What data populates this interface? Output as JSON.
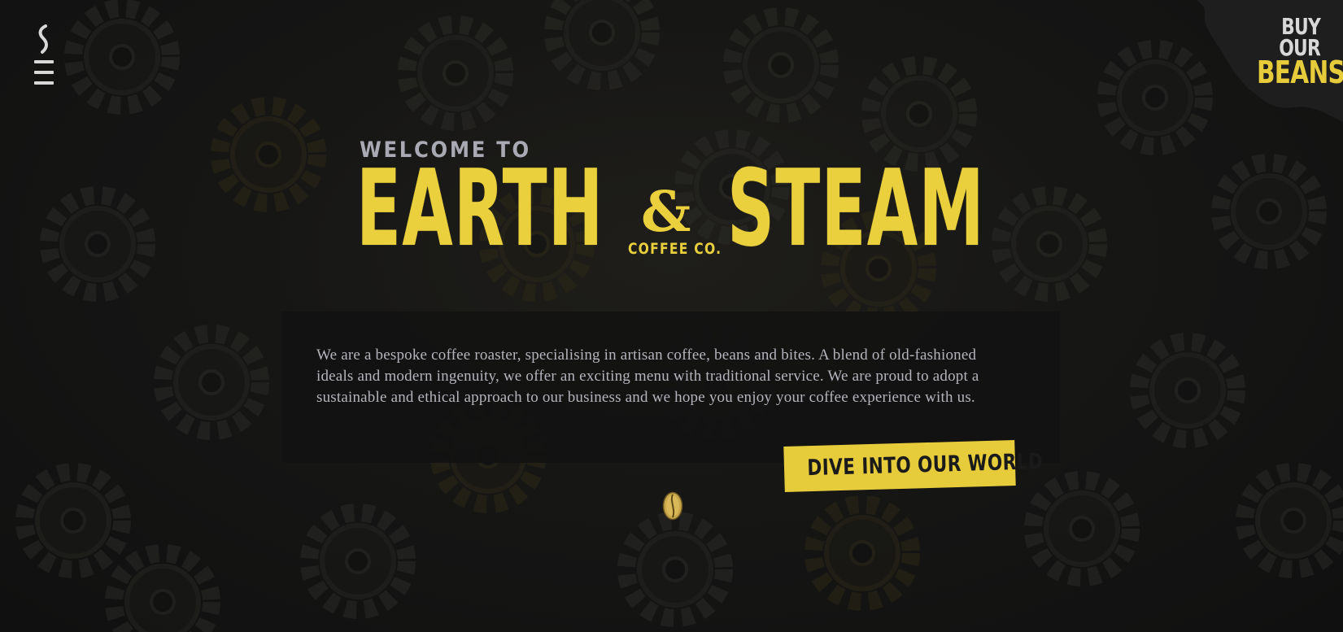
{
  "nav": {
    "logo_icon": "steam-swirl-icon",
    "menu_icon": "hamburger-menu-icon"
  },
  "shop_link": {
    "line1": "BUY OUR",
    "line2": "BEANS"
  },
  "hero": {
    "welcome": "WELCOME TO",
    "brand_part1": "EARTH",
    "brand_amp": "&",
    "brand_part2": "STEAM",
    "brand_sub": "COFFEE CO."
  },
  "intro": {
    "text": "We are a bespoke coffee roaster, specialising in artisan coffee, beans and bites. A blend of old-fashioned ideals and modern ingenuity, we offer an exciting menu with traditional service. We are proud to adopt a sustainable and ethical approach to our business and we hope you enjoy your coffee experience with us."
  },
  "cta": {
    "label": "DIVE INTO OUR WORLD"
  },
  "scroll_indicator": {
    "icon": "coffee-bean-icon"
  },
  "colors": {
    "background": "#141414",
    "accent_yellow": "#e6cb3a",
    "text_grey": "#b4b4bc",
    "panel": "#121212"
  }
}
